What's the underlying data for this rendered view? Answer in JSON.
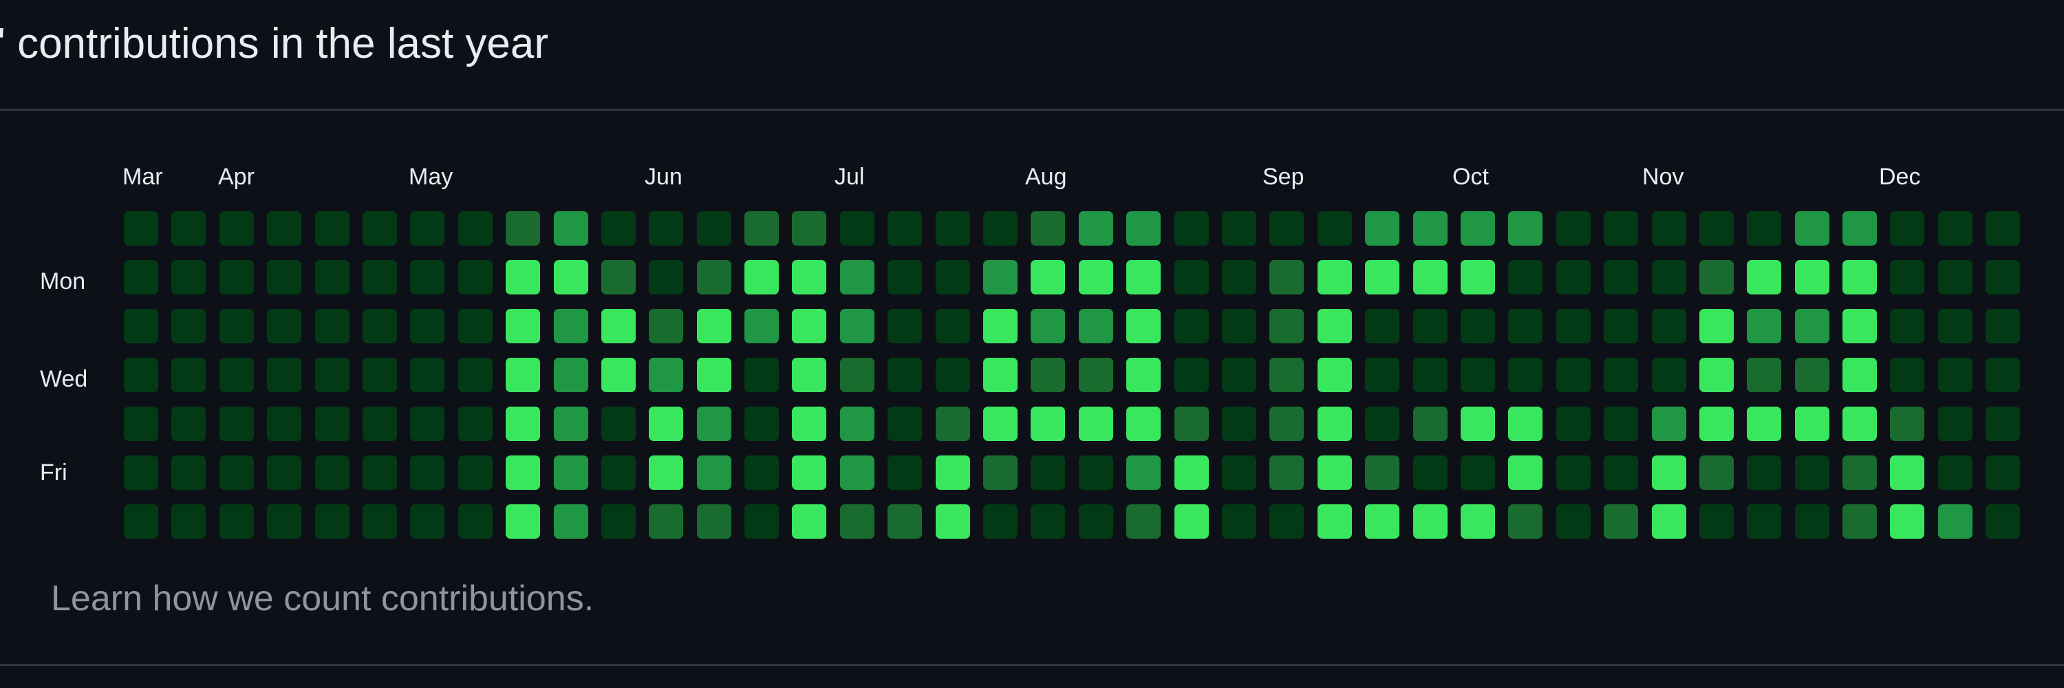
{
  "header": {
    "title": "' contributions in the last year"
  },
  "months": [
    "Mar",
    "Apr",
    "May",
    "Jun",
    "Jul",
    "Aug",
    "Sep",
    "Oct",
    "Nov",
    "Dec"
  ],
  "day_labels": [
    "Mon",
    "Wed",
    "Fri"
  ],
  "footer": {
    "learn_link": "Learn how we count contributions."
  },
  "colors": {
    "background": "#0d1117",
    "level_0": "#033a16",
    "level_1": "#196c2e",
    "level_2": "#1f9744",
    "level_3": "#2ad54f",
    "level_4": "#39e75f",
    "divider": "#30363d",
    "muted_text": "#8d96a0"
  },
  "contribution_levels": [
    [
      0,
      0,
      0,
      0,
      0,
      0,
      0,
      0,
      1,
      2,
      0,
      0,
      0,
      1,
      1,
      0,
      0,
      0,
      0,
      1,
      2,
      2,
      0,
      0,
      0,
      0,
      2,
      2,
      2,
      2,
      0,
      0,
      0,
      0,
      0,
      2,
      2,
      0,
      0,
      0
    ],
    [
      0,
      0,
      0,
      0,
      0,
      0,
      0,
      0,
      4,
      4,
      1,
      0,
      1,
      4,
      4,
      2,
      0,
      0,
      2,
      4,
      4,
      4,
      0,
      0,
      1,
      4,
      4,
      4,
      4,
      0,
      0,
      0,
      0,
      1,
      4,
      4,
      4,
      0,
      0,
      0
    ],
    [
      0,
      0,
      0,
      0,
      0,
      0,
      0,
      0,
      4,
      2,
      4,
      1,
      4,
      2,
      4,
      2,
      0,
      0,
      4,
      2,
      2,
      4,
      0,
      0,
      1,
      4,
      0,
      0,
      0,
      0,
      0,
      0,
      0,
      4,
      2,
      2,
      4,
      0,
      0,
      0
    ],
    [
      0,
      0,
      0,
      0,
      0,
      0,
      0,
      0,
      4,
      2,
      4,
      2,
      4,
      0,
      4,
      1,
      0,
      0,
      4,
      1,
      1,
      4,
      0,
      0,
      1,
      4,
      0,
      0,
      0,
      0,
      0,
      0,
      0,
      4,
      1,
      1,
      4,
      0,
      0,
      0
    ],
    [
      0,
      0,
      0,
      0,
      0,
      0,
      0,
      0,
      4,
      2,
      0,
      4,
      2,
      0,
      4,
      2,
      0,
      1,
      4,
      4,
      4,
      4,
      1,
      0,
      1,
      4,
      0,
      1,
      4,
      4,
      0,
      0,
      2,
      4,
      4,
      4,
      4,
      1,
      0,
      0
    ],
    [
      0,
      0,
      0,
      0,
      0,
      0,
      0,
      0,
      4,
      2,
      0,
      4,
      2,
      0,
      4,
      2,
      0,
      4,
      1,
      0,
      0,
      2,
      4,
      0,
      1,
      4,
      1,
      0,
      0,
      4,
      0,
      0,
      4,
      1,
      0,
      0,
      1,
      4,
      0,
      0
    ],
    [
      0,
      0,
      0,
      0,
      0,
      0,
      0,
      0,
      4,
      2,
      0,
      1,
      1,
      0,
      4,
      1,
      1,
      4,
      0,
      0,
      0,
      1,
      4,
      0,
      0,
      4,
      4,
      4,
      4,
      1,
      0,
      1,
      4,
      0,
      0,
      0,
      1,
      4,
      2,
      0
    ]
  ]
}
